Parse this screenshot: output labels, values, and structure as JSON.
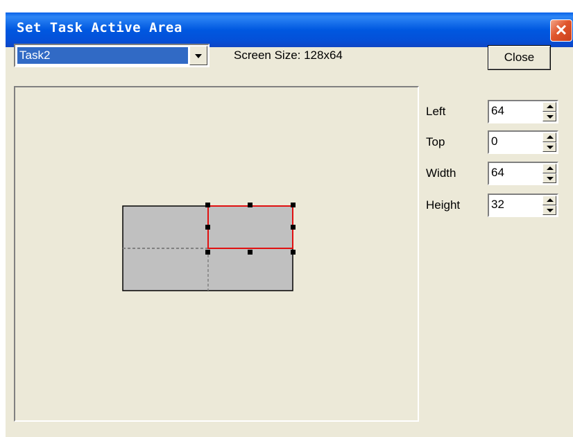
{
  "window": {
    "title": "Set Task Active Area",
    "close_glyph": "✕"
  },
  "task_select": {
    "selected": "Task2"
  },
  "screen_size_text": "Screen Size: 128x64",
  "close_button": "Close",
  "fields": [
    {
      "label": "Left",
      "value": "64"
    },
    {
      "label": "Top",
      "value": "0"
    },
    {
      "label": "Width",
      "value": "64"
    },
    {
      "label": "Height",
      "value": "32"
    }
  ],
  "colors": {
    "titlebar": "#0058e0",
    "selection_border": "#e01010",
    "area_fill": "#c0c0c0",
    "dialog_bg": "#ece9d8"
  },
  "icons": [
    "close-icon",
    "dropdown-arrow-icon",
    "spin-up-icon",
    "spin-down-icon"
  ]
}
